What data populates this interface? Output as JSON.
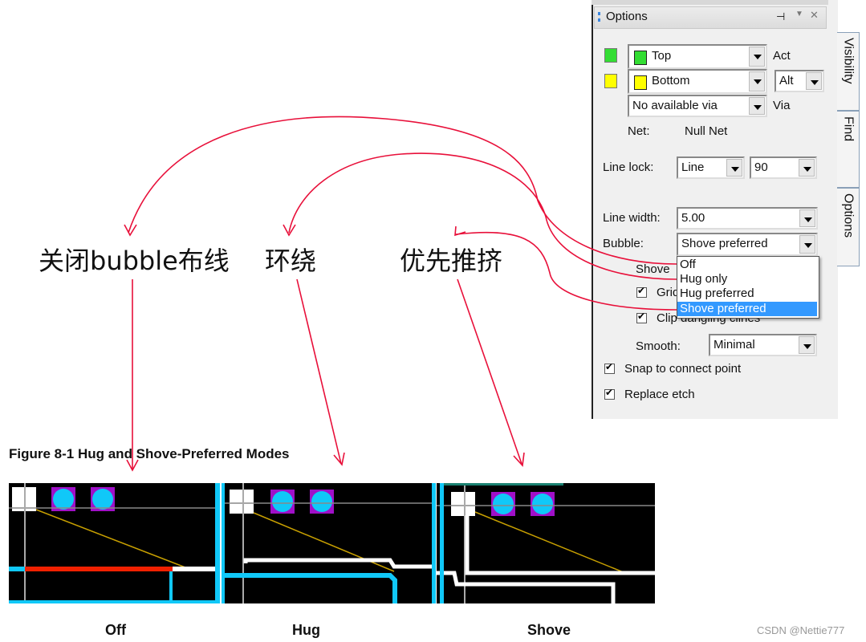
{
  "panel": {
    "title": "Options",
    "pin_icon": "pin-icon",
    "close_icon": "close-icon",
    "side_tabs": [
      "Visibility",
      "Find",
      "Options"
    ],
    "layers": {
      "active": {
        "name": "Top",
        "color": "#33dd33",
        "label": "Act"
      },
      "alternate": {
        "name": "Bottom",
        "color": "#ffff00",
        "label": "Alt",
        "alt_value": "Alt"
      }
    },
    "via": {
      "value": "No available via",
      "label": "Via"
    },
    "net": {
      "label": "Net:",
      "value": "Null Net"
    },
    "line_lock": {
      "label": "Line lock:",
      "type": "Line",
      "angle": "90"
    },
    "line_width": {
      "label": "Line width:",
      "value": "5.00"
    },
    "bubble": {
      "label": "Bubble:",
      "value": "Shove preferred",
      "options": [
        "Off",
        "Hug only",
        "Hug preferred",
        "Shove preferred"
      ],
      "selected_index": 3
    },
    "shove_label": "Shove",
    "gridded_label": "Grid",
    "clip_label": "Clip dangling clines",
    "smooth": {
      "label": "Smooth:",
      "value": "Minimal"
    },
    "snap_label": "Snap to connect point",
    "replace_label": "Replace etch"
  },
  "annotations": {
    "off_text": "关闭bubble布线",
    "hug_text": "环绕",
    "shove_text": "优先推挤",
    "arrow_color": "#e8103a"
  },
  "figure": {
    "title": "Figure 8-1  Hug and Shove-Preferred Modes",
    "captions": [
      "Off",
      "Hug",
      "Shove"
    ]
  },
  "watermark": "CSDN @Nettie777"
}
